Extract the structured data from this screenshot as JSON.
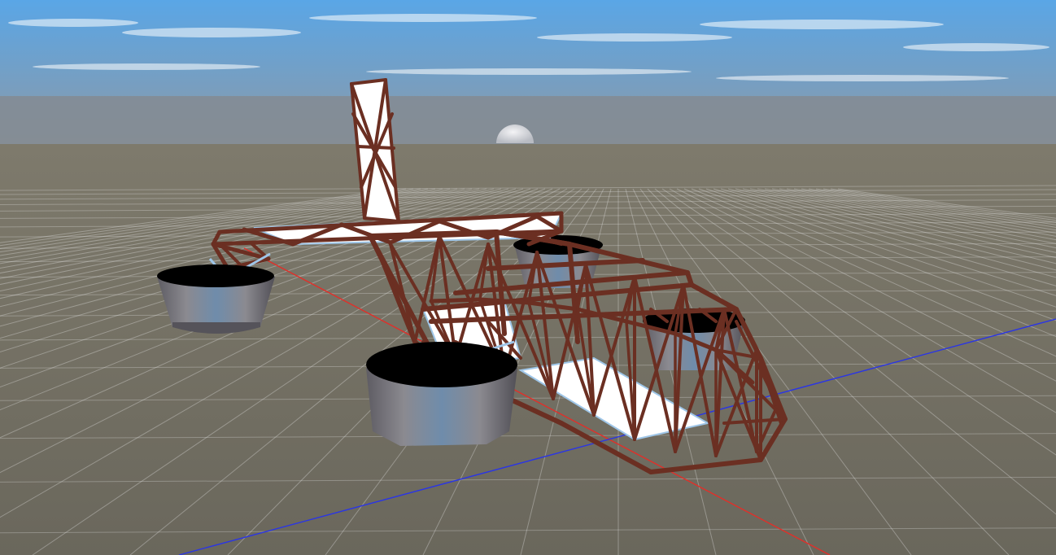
{
  "scene": {
    "kind": "3d-viewport",
    "camera": "perspective",
    "objects": [
      "ground-grid",
      "x-axis-line",
      "z-axis-line",
      "moon",
      "truss-vehicle",
      "thruster-front-left",
      "thruster-front-right",
      "thruster-rear-left",
      "thruster-rear-right"
    ]
  },
  "colors": {
    "sky_top": "#5aa6e6",
    "sky_horizon": "#8c99a6",
    "haze": "#7d8388",
    "ground": "#7e7a6c",
    "ground_near": "#6a675c",
    "grid": "#e9e9e9",
    "axis_x": "#e0302a",
    "axis_z": "#2a35e6",
    "truss": "#6b2f22",
    "truss_highlight": "#8a4433",
    "panel": "#ffffff",
    "panel_edge": "#9fc6e8",
    "thruster_top": "#000000",
    "thruster_side": "#7c7a7e",
    "moon": "#e3e3e6"
  }
}
